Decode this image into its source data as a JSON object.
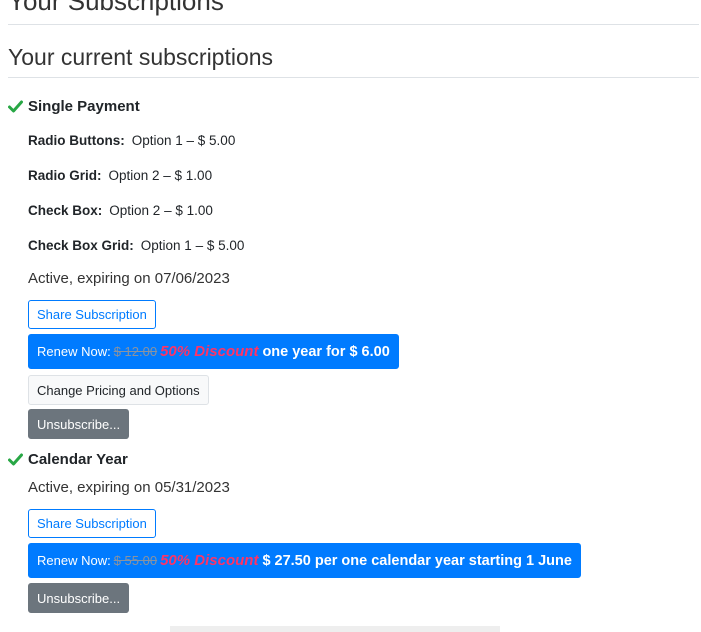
{
  "page": {
    "title": "Your Subscriptions",
    "section_title": "Your current subscriptions"
  },
  "colors": {
    "accent": "#007bff",
    "check": "#28a745",
    "discount": "#ff3366",
    "secondary": "#6c757d"
  },
  "subscriptions": [
    {
      "name": "Single Payment",
      "options": [
        {
          "label": "Radio Buttons:",
          "value": "Option 1 – $ 5.00"
        },
        {
          "label": "Radio Grid:",
          "value": "Option 2 – $ 1.00"
        },
        {
          "label": "Check Box:",
          "value": "Option 2 – $ 1.00"
        },
        {
          "label": "Check Box Grid:",
          "value": "Option 1 – $ 5.00"
        }
      ],
      "status": "Active, expiring on 07/06/2023",
      "share_label": "Share Subscription",
      "renew": {
        "prefix": "Renew Now:",
        "old_price": "$ 12.00",
        "discount": "50% Discount",
        "offer": "one year for $ 6.00"
      },
      "change_label": "Change Pricing and Options",
      "unsubscribe_label": "Unsubscribe..."
    },
    {
      "name": "Calendar Year",
      "status": "Active, expiring on 05/31/2023",
      "share_label": "Share Subscription",
      "renew": {
        "prefix": "Renew Now:",
        "old_price": "$ 55.00",
        "discount": "50% Discount",
        "offer": "$ 27.50 per one calendar year starting 1 June"
      },
      "unsubscribe_label": "Unsubscribe..."
    }
  ]
}
